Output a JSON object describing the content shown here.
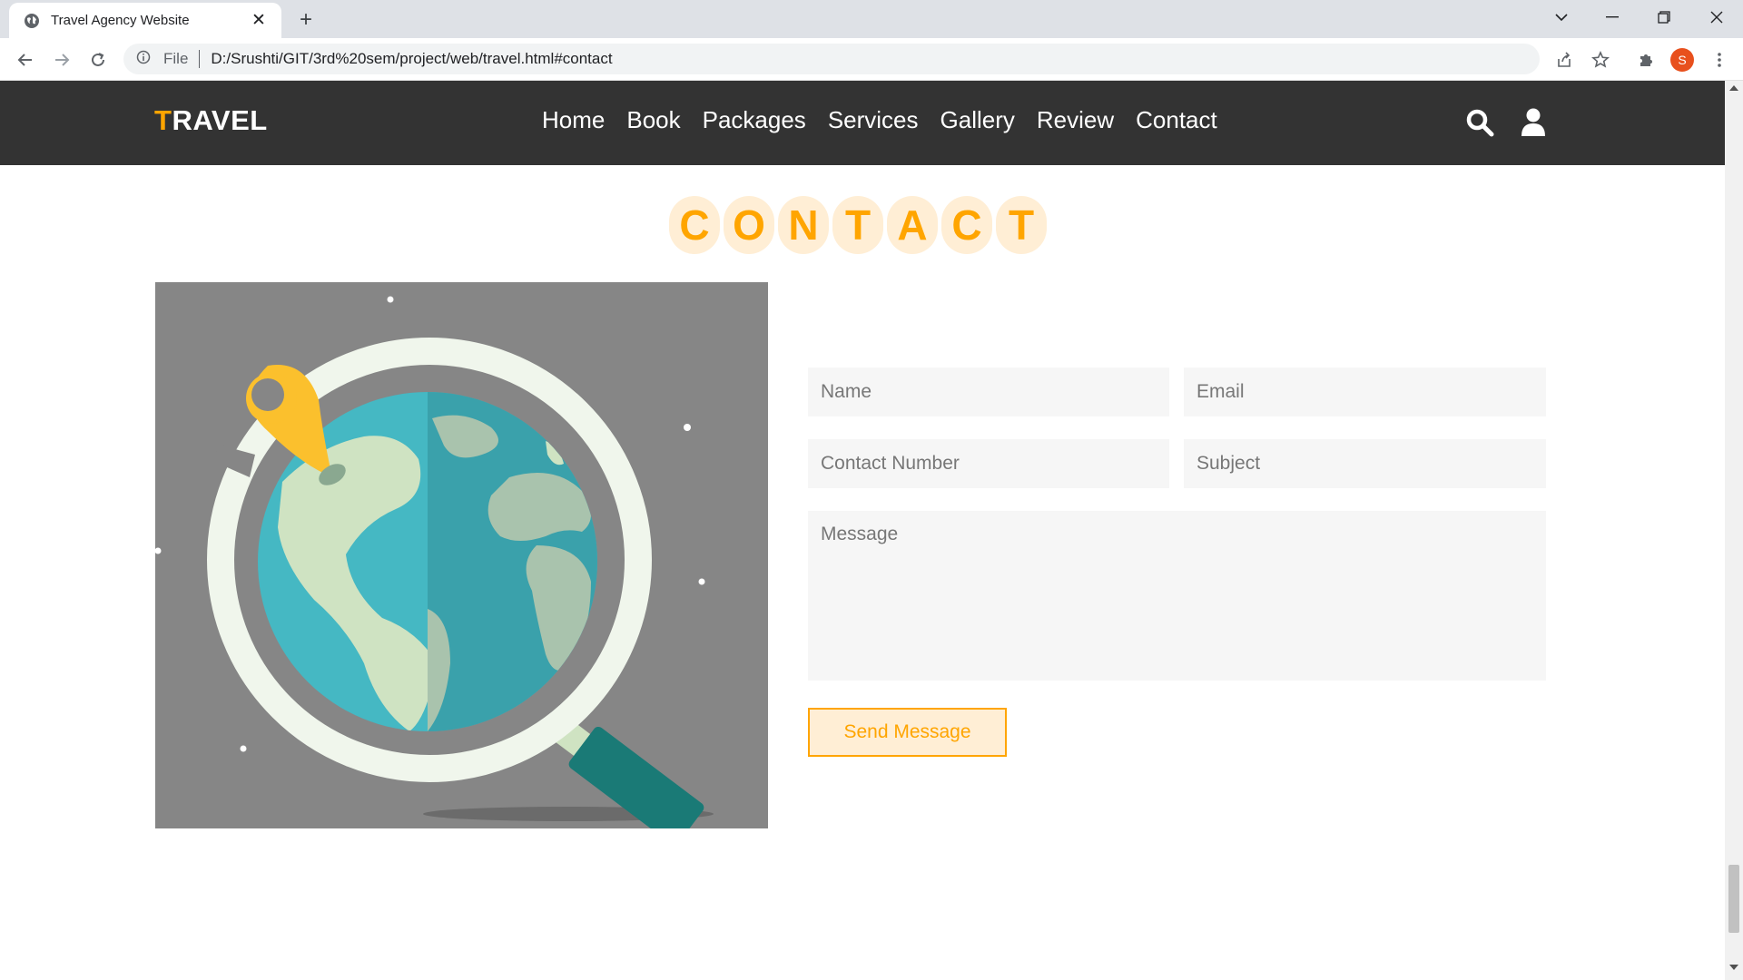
{
  "browser": {
    "tab_title": "Travel Agency Website",
    "tab_close": "✕",
    "new_tab": "+",
    "file_label": "File",
    "url": "D:/Srushti/GIT/3rd%20sem/project/web/travel.html#contact",
    "profile_initial": "S"
  },
  "site": {
    "logo_first": "T",
    "logo_rest": "RAVEL",
    "accent_color": "#ffa500",
    "header_bg": "#333333",
    "nav": [
      "Home",
      "Book",
      "Packages",
      "Services",
      "Gallery",
      "Review",
      "Contact"
    ],
    "header_icons": [
      "search-icon",
      "user-icon"
    ]
  },
  "contact": {
    "heading_letters": [
      "C",
      "O",
      "N",
      "T",
      "A",
      "C",
      "T"
    ],
    "form": {
      "name_placeholder": "Name",
      "email_placeholder": "Email",
      "phone_placeholder": "Contact Number",
      "subject_placeholder": "Subject",
      "message_placeholder": "Message",
      "send_label": "Send Message"
    },
    "illustration": "globe-magnifier-map-pin"
  }
}
